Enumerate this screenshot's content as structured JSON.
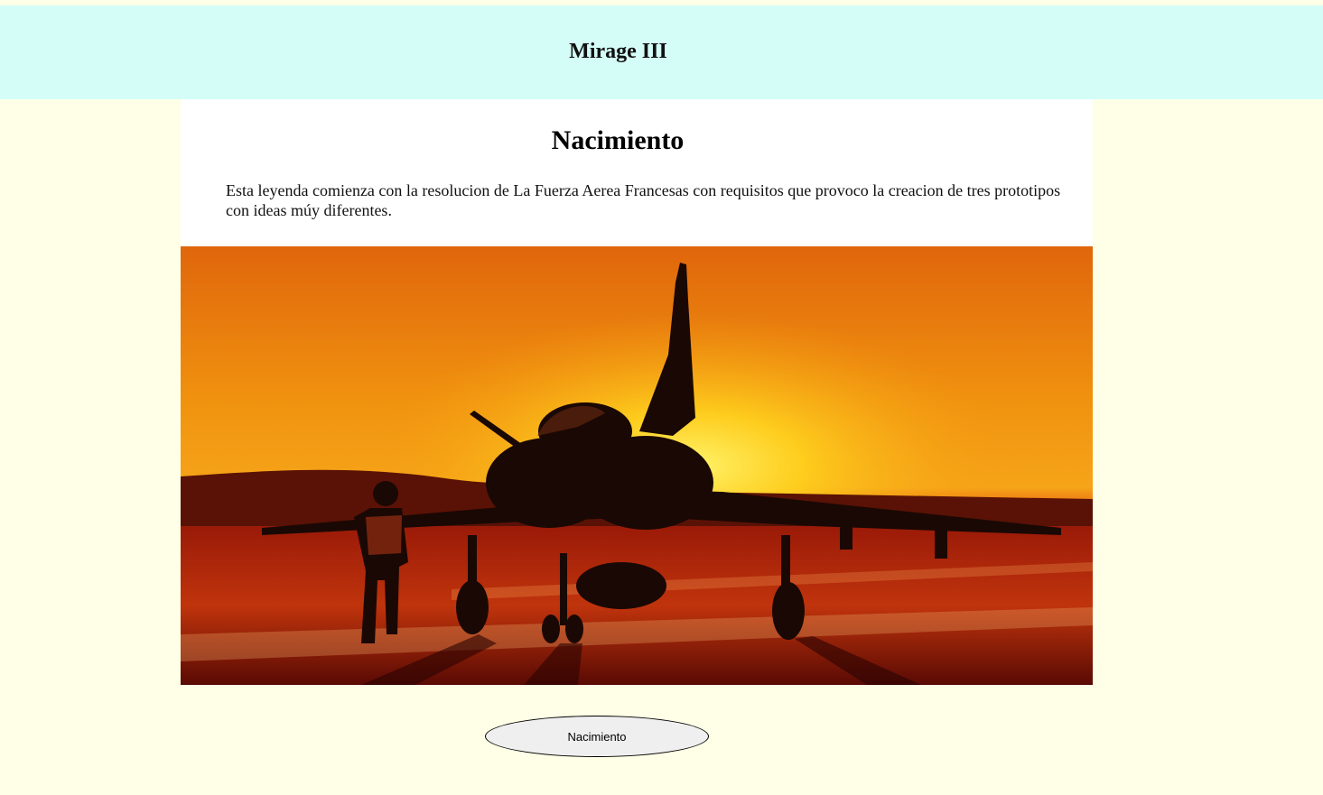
{
  "header": {
    "title": "Mirage III"
  },
  "section": {
    "title": "Nacimiento",
    "text": "Esta leyenda comienza con la resolucion de La Fuerza Aerea Francesas con requisitos que provoco la creacion de tres prototipos con ideas múy diferentes."
  },
  "image": {
    "alt": "Mirage jet silhouetted against a sunset with a ground crew member walking"
  },
  "button": {
    "label": "Nacimiento"
  }
}
